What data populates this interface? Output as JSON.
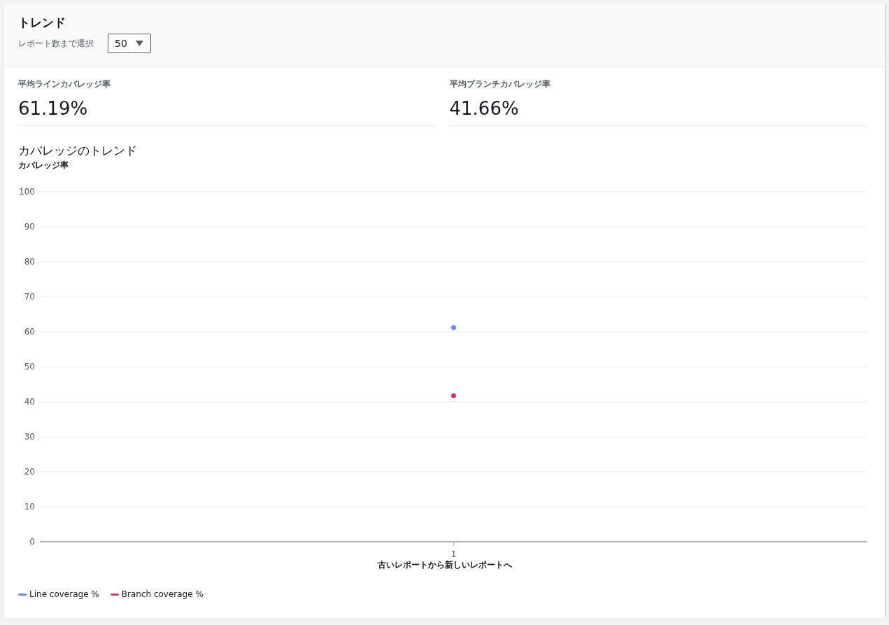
{
  "header": {
    "title": "トレンド",
    "select_label": "レポート数まで選択",
    "select_value": "50"
  },
  "metrics": [
    {
      "label": "平均ラインカバレッジ率",
      "value": "61.19%"
    },
    {
      "label": "平均ブランチカバレッジ率",
      "value": "41.66%"
    }
  ],
  "chart": {
    "title": "カバレッジのトレンド",
    "chart_data": {
      "type": "line",
      "ylabel": "カバレッジ率",
      "xlabel": "古いレポートから新しいレポートへ",
      "categories": [
        "1"
      ],
      "ylim": [
        0,
        100
      ],
      "grid": true,
      "yticks": [
        0,
        10,
        20,
        30,
        40,
        50,
        60,
        70,
        80,
        90,
        100
      ],
      "series": [
        {
          "name": "Line coverage %",
          "color": "#688ae8",
          "marker": "circle",
          "values": [
            61.2
          ]
        },
        {
          "name": "Branch coverage %",
          "color": "#c33d69",
          "marker": "circle",
          "values": [
            41.7
          ]
        }
      ]
    }
  }
}
